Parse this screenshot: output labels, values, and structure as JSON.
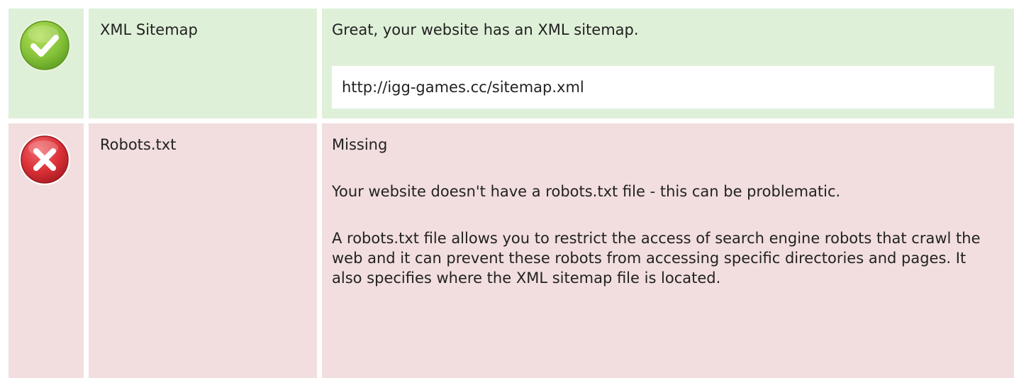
{
  "checks": [
    {
      "status": "pass",
      "status_icon": "checkmark-circle-icon",
      "status_color": "#8cc63f",
      "row_color": "#dff0d8",
      "label": "XML Sitemap",
      "message": "Great, your website has an XML sitemap.",
      "url": "http://igg-games.cc/sitemap.xml"
    },
    {
      "status": "fail",
      "status_icon": "cross-circle-icon",
      "status_color": "#d9303a",
      "row_color": "#f2dede",
      "label": "Robots.txt",
      "title": "Missing",
      "paragraph_1": "Your website doesn't have a robots.txt file - this can be problematic.",
      "paragraph_2": "A robots.txt file allows you to restrict the access of search engine robots that crawl the web and it can prevent these robots from accessing specific directories and pages. It also specifies where the XML sitemap file is located."
    }
  ]
}
